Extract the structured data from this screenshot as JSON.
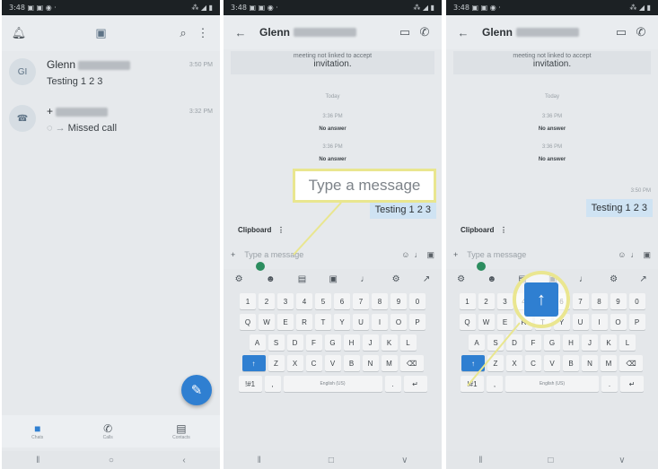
{
  "panel1": {
    "status_left": "3:48 ▣ ▣ ◉ ·",
    "status_right": "⁂ ◢ ▮",
    "conversations": [
      {
        "name": "Glenn",
        "preview": "Testing 1 2 3",
        "time": "3:50 PM",
        "avatar": "GI"
      },
      {
        "name": "+",
        "preview": "Missed call",
        "time": "3:32 PM",
        "avatar": "☎"
      }
    ],
    "nav": [
      {
        "label": "Chats",
        "icon": "chat-icon"
      },
      {
        "label": "Calls",
        "icon": "phone-icon"
      },
      {
        "label": "Contacts",
        "icon": "contacts-icon"
      }
    ]
  },
  "chat": {
    "contact": "Glenn",
    "invite_line1": "meeting not linked to accept",
    "invite_line2": "invitation.",
    "day": "Today",
    "calls": [
      {
        "time": "3:36 PM",
        "status": "No answer"
      },
      {
        "time": "3:36 PM",
        "status": "No answer"
      }
    ],
    "bubble_time": "3:50 PM",
    "bubble": "Testing 1 2 3",
    "clipboard": "Clipboard",
    "composer_placeholder": "Type a message",
    "callout_text": "Type a message",
    "keyboard": {
      "numbers": [
        "1",
        "2",
        "3",
        "4",
        "5",
        "6",
        "7",
        "8",
        "9",
        "0"
      ],
      "row1": [
        "Q",
        "W",
        "E",
        "R",
        "T",
        "Y",
        "U",
        "I",
        "O",
        "P"
      ],
      "row2": [
        "A",
        "S",
        "D",
        "F",
        "G",
        "H",
        "J",
        "K",
        "L"
      ],
      "row3": [
        "Z",
        "X",
        "C",
        "V",
        "B",
        "N",
        "M"
      ],
      "sym": "!#1",
      "comma": ",",
      "space": "English (US)",
      "period": ".",
      "enter": "↵"
    }
  },
  "colors": {
    "accent": "#2f7fd1",
    "callout": "#e9e68f"
  }
}
